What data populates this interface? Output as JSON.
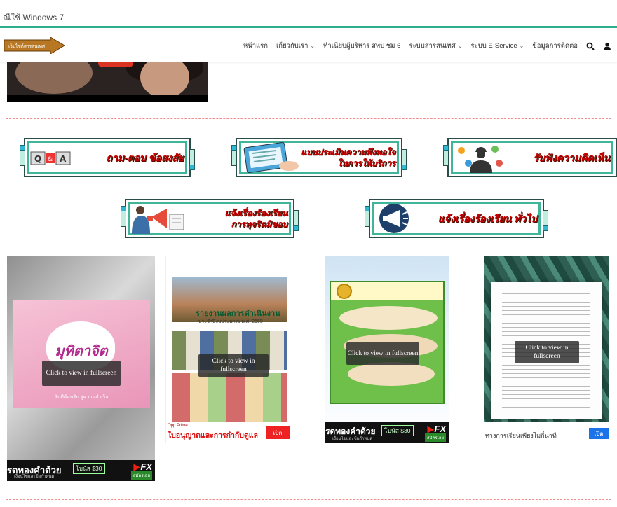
{
  "topbar": {
    "text": "ณีใช้ Windows 7"
  },
  "logo": {
    "text": "เว็บไซต์สารสนเทศ"
  },
  "nav": {
    "items": [
      {
        "label": "หน้าแรก",
        "dropdown": false
      },
      {
        "label": "เกี่ยวกับเรา",
        "dropdown": true
      },
      {
        "label": "ทำเนียบผู้บริหาร สพป ชม 6",
        "dropdown": false
      },
      {
        "label": "ระบบสารสนเทศ",
        "dropdown": true
      },
      {
        "label": "ระบบ E-Service",
        "dropdown": true
      },
      {
        "label": "ข้อมูลการติดต่อ",
        "dropdown": false
      }
    ],
    "icons": [
      "search-icon",
      "user-icon"
    ]
  },
  "banners": [
    {
      "line1": "ถาม-ตอบ ข้อสงสัย",
      "line2": "",
      "icon": "qa-icon"
    },
    {
      "line1": "แบบประเมินความพึงพอใจ",
      "line2": "ในการให้บริการ",
      "icon": "survey-icon"
    },
    {
      "line1": "รับฟังความคิดเห็น",
      "line2": "",
      "icon": "feedback-icon"
    },
    {
      "line1": "แจ้งเรื่องร้องเรียน",
      "line2": "การทุจริตมิชอบ",
      "icon": "megaphone-icon"
    },
    {
      "line1": "แจ้งเรื่องร้องเรียน ทั่วไป",
      "line2": "",
      "icon": "megaphone-icon"
    }
  ],
  "cards": [
    {
      "cta": "Click to view in fullscreen",
      "title": "มุทิตาจิต",
      "caption": "ยินดีต้อนรับ สู่ความสำเร็จ"
    },
    {
      "cta": "Click to view in fullscreen",
      "title": "รายงานผลการดำเนินงาน",
      "caption": "ประจำปีงบประมาณ พ.ศ. 2565"
    },
    {
      "cta": "Click to view in fullscreen",
      "title": "",
      "caption": ""
    },
    {
      "cta": "Click to view in fullscreen",
      "title": "",
      "caption": ""
    }
  ],
  "ads": {
    "gold": {
      "title": "รดทองคำด้วย",
      "bonus": "โบนัส $30",
      "brand_fx": "FX",
      "sub": "เงื่อนไขและข้อกำหนด",
      "go": "สมัครเลย"
    },
    "trading": {
      "tag": "Opp Prime",
      "title": "ใบอนุญาตและการกำกับดูแล",
      "button": "เปิด"
    },
    "study": {
      "title": "ทางการเรียนเพียงไม่กี่นาที",
      "button": "เปิด"
    }
  },
  "colors": {
    "accent": "#2cae8d",
    "banner_text": "#c40000",
    "divider": "#f28b8b"
  }
}
